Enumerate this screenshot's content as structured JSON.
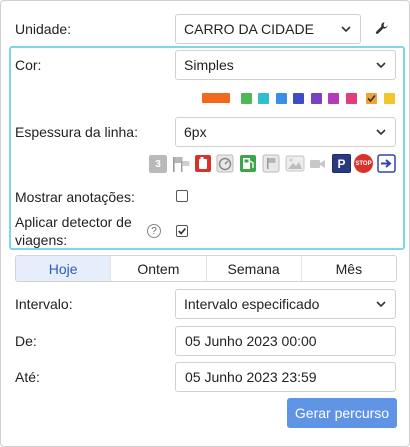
{
  "unit": {
    "label": "Unidade:",
    "value": "CARRO DA CIDADE"
  },
  "color": {
    "label": "Cor:",
    "value": "Simples",
    "swatches": [
      "#f0691e",
      "#4cb954",
      "#2fbfd0",
      "#3a8ee6",
      "#3e4cc7",
      "#7b3fc4",
      "#b33ab8",
      "#e03f7c",
      "#f0a238",
      "#f2c62b"
    ],
    "selected_swatch_index": 8
  },
  "line_width": {
    "label": "Espessura da linha:",
    "value": "6px"
  },
  "markers": {
    "first_badge": "3",
    "stop_badge": "STOP",
    "parking_badge": "P",
    "icons": [
      "number-marker-icon",
      "flags-icon",
      "fuel-can-icon",
      "speed-gauge-icon",
      "fuel-station-icon",
      "flag-icon",
      "photo-icon",
      "video-icon",
      "parking-icon",
      "stop-sign-icon",
      "arrow-icon"
    ]
  },
  "annotations": {
    "label": "Mostrar anotações:",
    "checked": false
  },
  "trip_detector": {
    "label_line1": "Aplicar detector de",
    "label_line2": "viagens:",
    "help": "?",
    "checked": true
  },
  "tabs": [
    {
      "label": "Hoje",
      "active": true
    },
    {
      "label": "Ontem",
      "active": false
    },
    {
      "label": "Semana",
      "active": false
    },
    {
      "label": "Mês",
      "active": false
    }
  ],
  "interval": {
    "label": "Intervalo:",
    "value": "Intervalo especificado"
  },
  "from": {
    "label": "De:",
    "value": "05 Junho 2023 00:00"
  },
  "to": {
    "label": "Até:",
    "value": "05 Junho 2023 23:59"
  },
  "submit_label": "Gerar percurso"
}
